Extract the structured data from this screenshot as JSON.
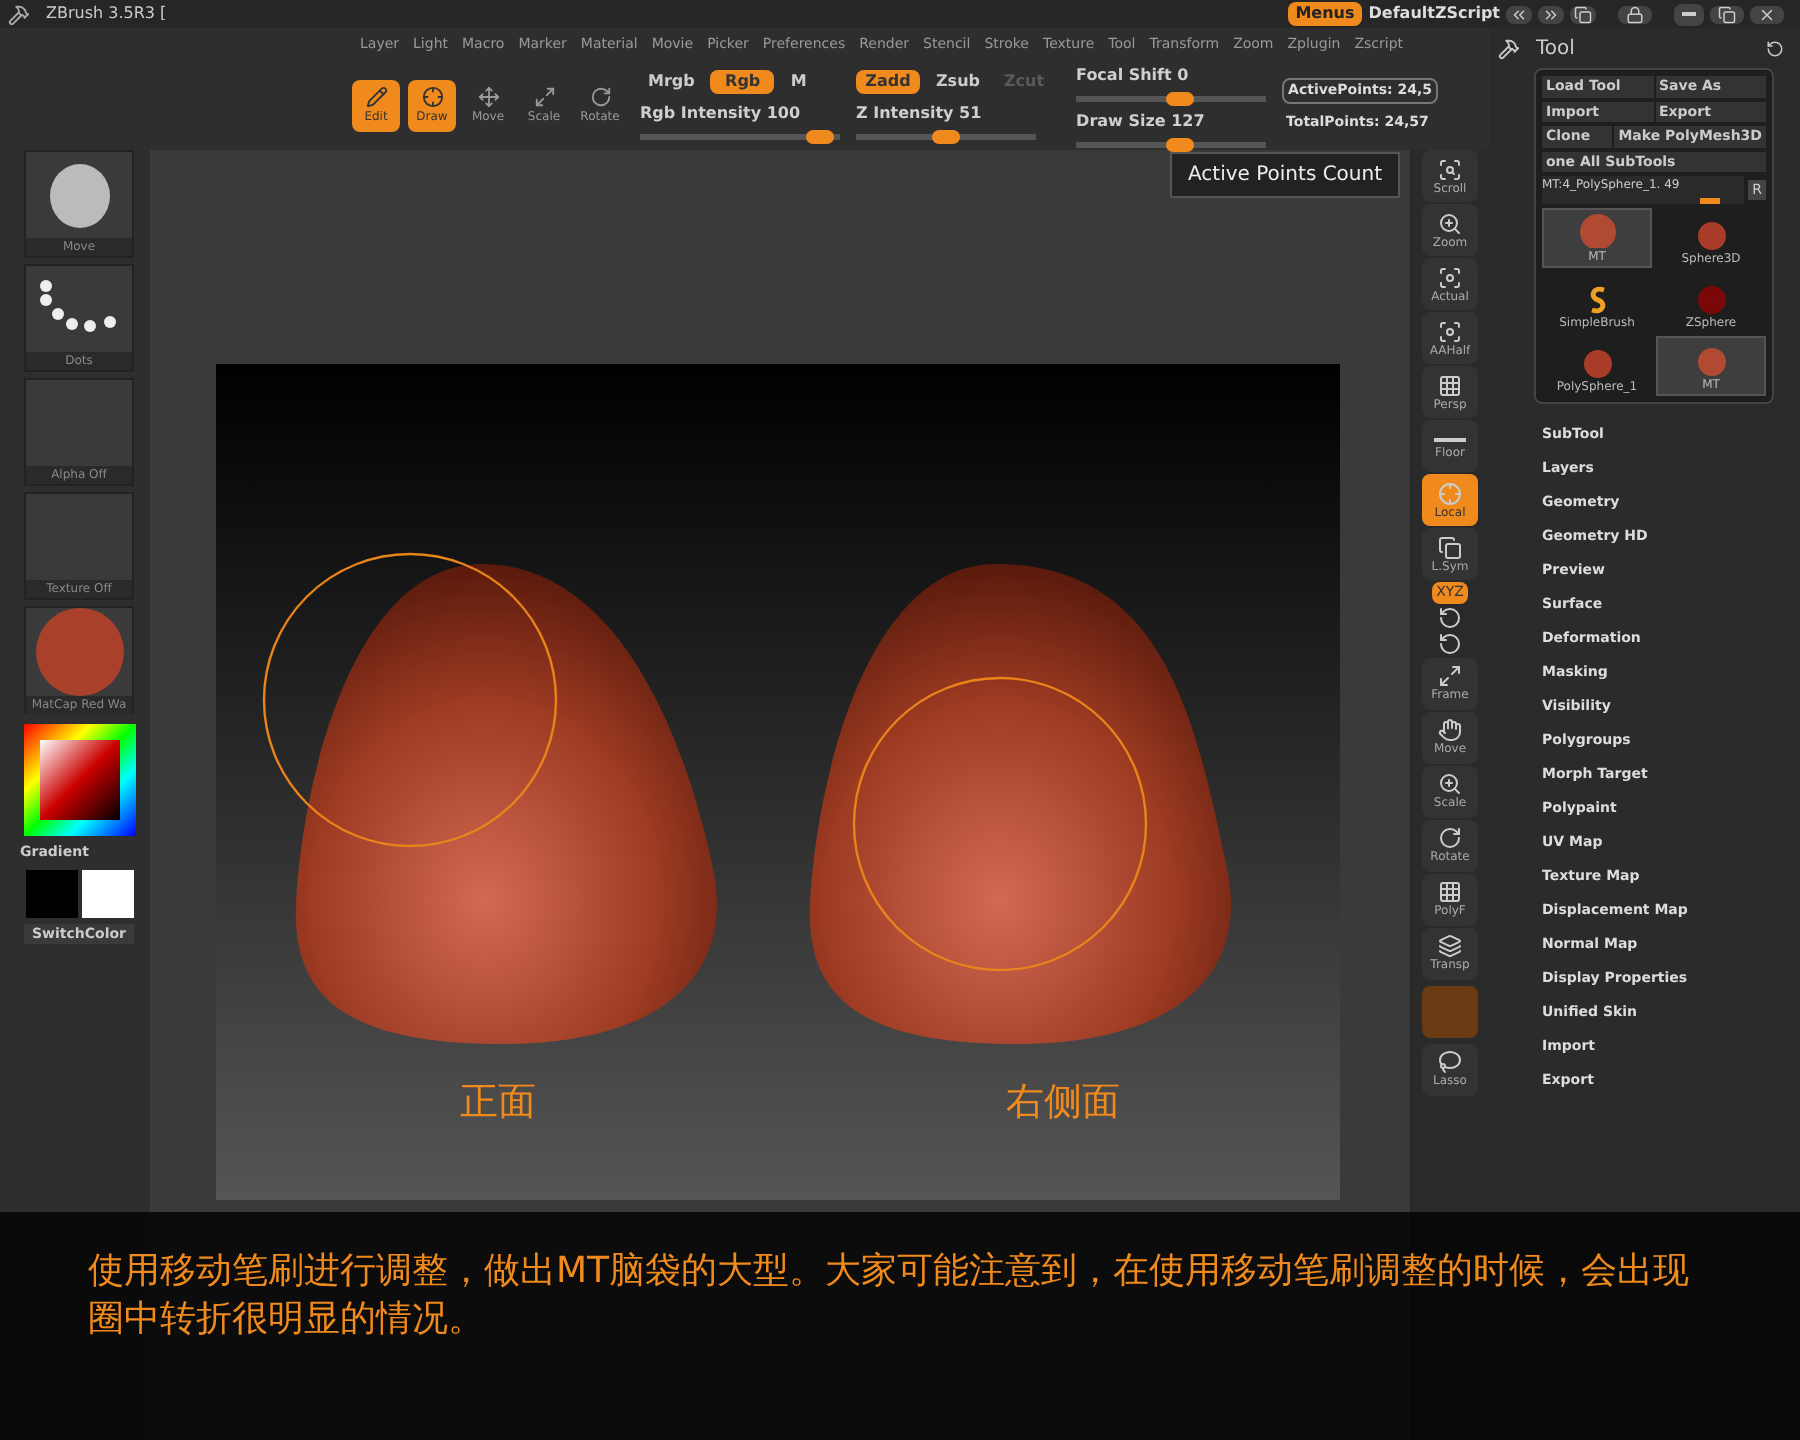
{
  "title_bar": {
    "title": "ZBrush 3.5R3 [",
    "menus_button": {
      "label": "Menus",
      "selected": true
    },
    "script": "DefaultZScript"
  },
  "menu_bar": [
    "Layer",
    "Light",
    "Macro",
    "Marker",
    "Material",
    "Movie",
    "Picker",
    "Preferences",
    "Render",
    "Stencil",
    "Stroke",
    "Texture",
    "Tool",
    "Transform",
    "Zoom",
    "Zplugin",
    "Zscript"
  ],
  "shelf": {
    "tools": [
      {
        "kind": "edit",
        "label": "Edit",
        "selected": true
      },
      {
        "kind": "draw",
        "label": "Draw",
        "selected": true
      },
      {
        "kind": "move",
        "label": "Move",
        "selected": false
      },
      {
        "kind": "scale",
        "label": "Scale",
        "selected": false
      },
      {
        "kind": "rotate",
        "label": "Rotate",
        "selected": false
      }
    ],
    "color_modes": [
      {
        "label": "Mrgb",
        "selected": false
      },
      {
        "label": "Rgb",
        "selected": true
      },
      {
        "label": "M",
        "selected": false
      }
    ],
    "rgb_intensity": {
      "label": "Rgb Intensity",
      "value": "100",
      "level": 0.9
    },
    "z_modes": [
      {
        "label": "Zadd",
        "selected": true,
        "disabled": false
      },
      {
        "label": "Zsub",
        "selected": false,
        "disabled": false
      },
      {
        "label": "Zcut",
        "selected": false,
        "disabled": true
      }
    ],
    "z_intensity": {
      "label": "Z Intensity",
      "value": "51",
      "level": 0.5
    },
    "focal_shift": {
      "label": "Focal Shift",
      "value": "0",
      "level": 0.55
    },
    "draw_size": {
      "label": "Draw Size",
      "value": "127",
      "level": 0.55
    },
    "active_points": "ActivePoints: 24,5",
    "total_points": "TotalPoints: 24,57"
  },
  "left_shelf": {
    "brush": "Move",
    "stroke": "Dots",
    "alpha": "Alpha Off",
    "texture": "Texture Off",
    "material": "MatCap Red Wa",
    "gradient": "Gradient",
    "switch_color": "SwitchColor"
  },
  "canvas": {
    "labels": [
      "正面",
      "右侧面"
    ]
  },
  "right_toolbar": [
    {
      "kind": "labeled",
      "label": "Scroll",
      "selected": false
    },
    {
      "kind": "labeled",
      "label": "Zoom",
      "selected": false
    },
    {
      "kind": "labeled",
      "label": "Actual",
      "selected": false
    },
    {
      "kind": "labeled",
      "label": "AAHalf",
      "selected": false
    },
    {
      "kind": "labeled",
      "label": "Persp",
      "selected": false
    },
    {
      "kind": "labeled",
      "label": "Floor",
      "selected": false
    },
    {
      "kind": "labeled",
      "label": "Local",
      "selected": true
    },
    {
      "kind": "labeled",
      "label": "L.Sym",
      "selected": false
    },
    {
      "kind": "small",
      "label": "XYZ",
      "selected": true
    },
    {
      "kind": "icon"
    },
    {
      "kind": "icon"
    },
    {
      "kind": "labeled",
      "label": "Frame",
      "selected": false
    },
    {
      "kind": "labeled",
      "label": "Move",
      "selected": false
    },
    {
      "kind": "labeled",
      "label": "Scale",
      "selected": false
    },
    {
      "kind": "labeled",
      "label": "Rotate",
      "selected": false
    },
    {
      "kind": "labeled",
      "label": "PolyF",
      "selected": false
    },
    {
      "kind": "labeled",
      "label": "Transp",
      "selected": false
    },
    {
      "kind": "dim"
    },
    {
      "kind": "labeled",
      "label": "Lasso",
      "selected": false
    }
  ],
  "tool_panel": {
    "title": "Tool",
    "buttons": [
      [
        "Load Tool",
        "Save As"
      ],
      [
        "Import",
        "Export"
      ],
      [
        "Clone",
        "Make PolyMesh3D"
      ],
      [
        "one All SubTools"
      ]
    ],
    "subtool_slider": {
      "value": "MT:4_PolySphere_1. 49",
      "level": 0.88
    },
    "r_button": "R",
    "thumbnails": [
      {
        "kind": "head",
        "label": "MT",
        "selected": true
      },
      {
        "kind": "sphere",
        "label": "Sphere3D",
        "selected": false
      },
      {
        "kind": "brush",
        "label": "SimpleBrush",
        "selected": false
      },
      {
        "kind": "zsphere",
        "label": "ZSphere",
        "selected": false
      },
      {
        "kind": "sphere",
        "label": "PolySphere_1",
        "selected": false
      },
      {
        "kind": "small_head",
        "label": "MT",
        "selected": true
      }
    ],
    "sections": [
      "SubTool",
      "Layers",
      "Geometry",
      "Geometry HD",
      "Preview",
      "Surface",
      "Deformation",
      "Masking",
      "Visibility",
      "Polygroups",
      "Morph Target",
      "Polypaint",
      "UV Map",
      "Texture Map",
      "Displacement Map",
      "Normal Map",
      "Display Properties",
      "Unified Skin",
      "Import",
      "Export"
    ]
  },
  "tooltip": "Active Points Count",
  "caption": "使用移动笔刷进行调整，做出MT脑袋的大型。大家可能注意到，在使用移动笔刷调整的时候，会出现圈中转折很明显的情况。"
}
